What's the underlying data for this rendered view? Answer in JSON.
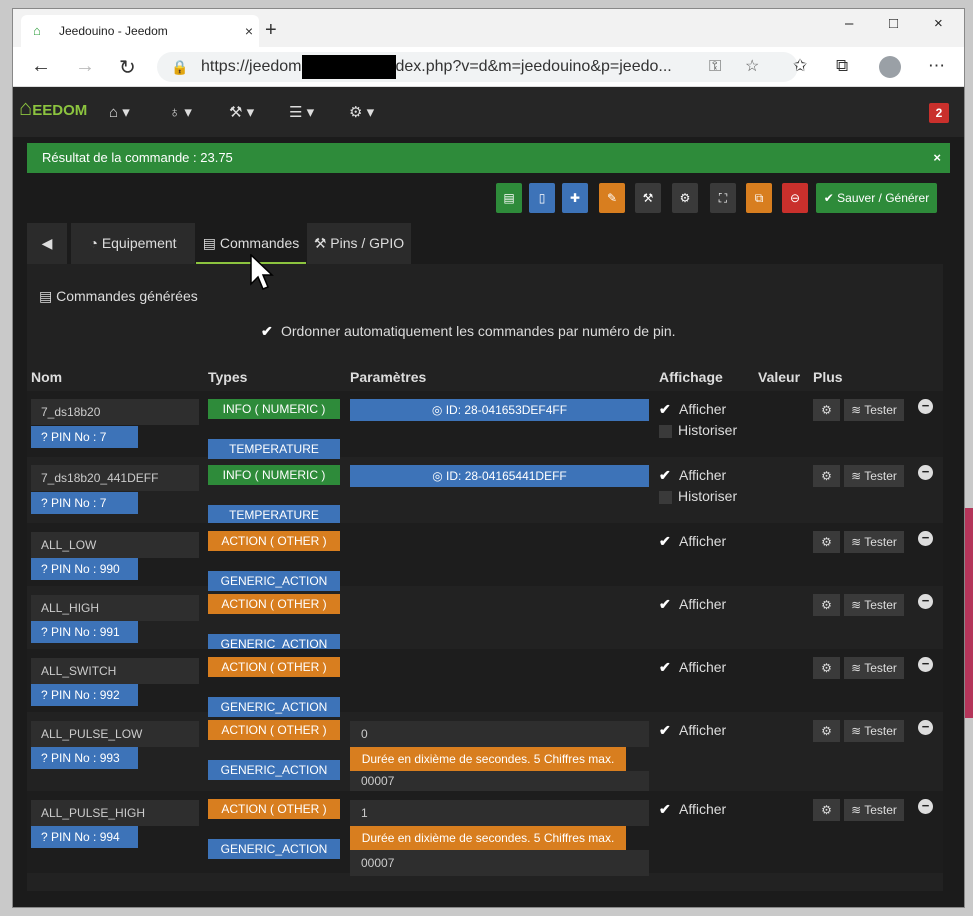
{
  "browser": {
    "tab_title": "Jeedouino - Jeedom",
    "tab_close": "×",
    "new_tab": "+",
    "url_prefix": "https://jeedom",
    "url_suffix": "dex.php?v=d&m=jeedouino&p=jeedo...",
    "win_min": "–",
    "win_max": "□",
    "win_close": "×"
  },
  "navbar": {
    "logo": "EEDOM",
    "badge": "2"
  },
  "alert": {
    "text": "Résultat de la commande : 23.75",
    "close": "×"
  },
  "save_button": "Sauver / Générer",
  "tabs": {
    "equipement": "Equipement",
    "commandes": "Commandes",
    "pins": "Pins / GPIO"
  },
  "section_title": "Commandes générées",
  "order_checkbox": "Ordonner automatiquement les commandes par numéro de pin.",
  "headers": {
    "nom": "Nom",
    "types": "Types",
    "parametres": "Paramètres",
    "affichage": "Affichage",
    "valeur": "Valeur",
    "plus": "Plus"
  },
  "labels": {
    "afficher": "Afficher",
    "historiser": "Historiser",
    "tester": "Tester",
    "hint": "Durée en dixième de secondes. 5 Chiffres max."
  },
  "commands": [
    {
      "name": "7_ds18b20",
      "pin": "PIN No : 7",
      "type": "INFO ( NUMERIC )",
      "subtype": "TEMPERATURE",
      "param": "ID: 28-041653DEF4FF"
    },
    {
      "name": "7_ds18b20_441DEFF",
      "pin": "PIN No : 7",
      "type": "INFO ( NUMERIC )",
      "subtype": "TEMPERATURE",
      "param": "ID: 28-04165441DEFF"
    },
    {
      "name": "ALL_LOW",
      "pin": "PIN No : 990",
      "type": "ACTION ( OTHER )",
      "subtype": "GENERIC_ACTION"
    },
    {
      "name": "ALL_HIGH",
      "pin": "PIN No : 991",
      "type": "ACTION ( OTHER )",
      "subtype": "GENERIC_ACTION"
    },
    {
      "name": "ALL_SWITCH",
      "pin": "PIN No : 992",
      "type": "ACTION ( OTHER )",
      "subtype": "GENERIC_ACTION"
    },
    {
      "name": "ALL_PULSE_LOW",
      "pin": "PIN No : 993",
      "type": "ACTION ( OTHER )",
      "subtype": "GENERIC_ACTION",
      "value": "0",
      "duration": "00007"
    },
    {
      "name": "ALL_PULSE_HIGH",
      "pin": "PIN No : 994",
      "type": "ACTION ( OTHER )",
      "subtype": "GENERIC_ACTION",
      "value": "1",
      "duration": "00007"
    }
  ],
  "colors": {
    "info": "#2e8b3a",
    "action": "#d87e1f",
    "subtype": "#3d73b8",
    "param": "#3d73b8"
  }
}
